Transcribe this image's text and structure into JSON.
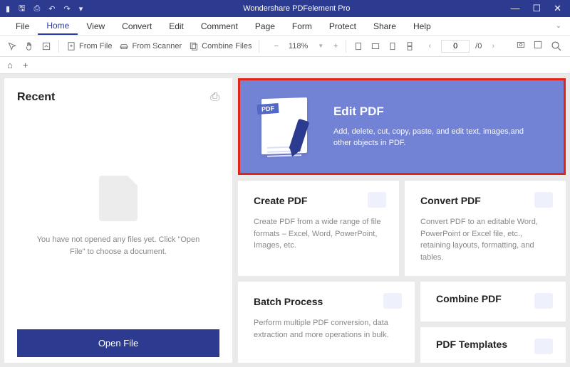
{
  "titlebar": {
    "title": "Wondershare PDFelement Pro"
  },
  "menu": {
    "items": [
      "File",
      "Home",
      "View",
      "Convert",
      "Edit",
      "Comment",
      "Page",
      "Form",
      "Protect",
      "Share",
      "Help"
    ],
    "active": 1
  },
  "toolbar": {
    "from_file": "From File",
    "from_scanner": "From Scanner",
    "combine": "Combine Files",
    "zoom": "118%",
    "page_current": "0",
    "page_total": "/0"
  },
  "recent": {
    "title": "Recent",
    "empty": "You have not opened any files yet. Click \"Open File\" to choose a document.",
    "open_btn": "Open File"
  },
  "hero": {
    "badge": "PDF",
    "title": "Edit PDF",
    "desc": "Add, delete, cut, copy, paste, and edit text, images,and other objects in PDF."
  },
  "cards": {
    "create": {
      "title": "Create PDF",
      "desc": "Create PDF from a wide range of file formats – Excel, Word, PowerPoint, Images, etc."
    },
    "convert": {
      "title": "Convert PDF",
      "desc": "Convert PDF to an editable Word, PowerPoint or Excel file, etc., retaining layouts, formatting, and tables."
    },
    "batch": {
      "title": "Batch Process",
      "desc": "Perform multiple PDF conversion, data extraction and more operations in bulk."
    },
    "combine": {
      "title": "Combine PDF"
    },
    "templates": {
      "title": "PDF Templates"
    }
  }
}
